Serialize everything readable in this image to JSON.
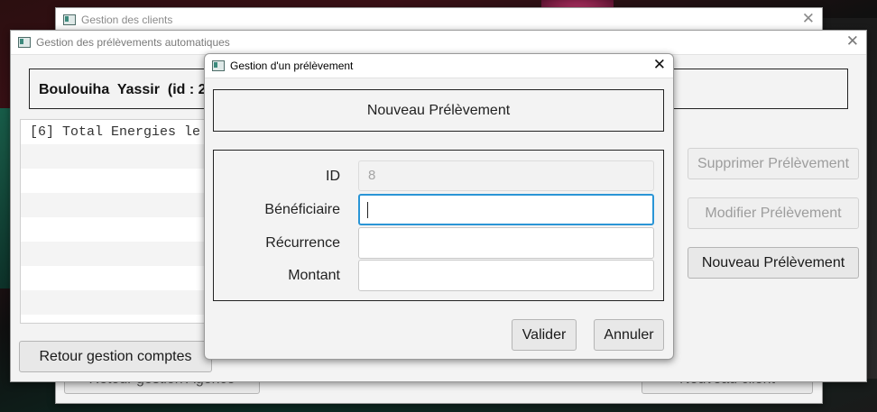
{
  "windows": {
    "clients": {
      "title": "Gestion des clients",
      "bottom_left_button": "Retour gestion Agence",
      "bottom_right_button": "Nouveau client"
    },
    "prelevements": {
      "title": "Gestion des prélèvements automatiques",
      "client_header": "Boulouiha  Yassir  (id : 2",
      "list_items": [
        "[6] Total Energies le",
        "",
        "",
        "",
        "",
        "",
        "",
        ""
      ],
      "buttons": {
        "supprimer": "Supprimer Prélèvement",
        "modifier": "Modifier Prélèvement",
        "nouveau": "Nouveau Prélèvement",
        "retour": "Retour gestion comptes"
      }
    },
    "prelevement_dialog": {
      "title": "Gestion d'un prélèvement",
      "heading": "Nouveau Prélèvement",
      "fields": {
        "id": {
          "label": "ID",
          "value": "8"
        },
        "beneficiaire": {
          "label": "Bénéficiaire",
          "value": ""
        },
        "recurrence": {
          "label": "Récurrence",
          "value": ""
        },
        "montant": {
          "label": "Montant",
          "value": ""
        }
      },
      "buttons": {
        "valider": "Valider",
        "annuler": "Annuler"
      }
    }
  }
}
